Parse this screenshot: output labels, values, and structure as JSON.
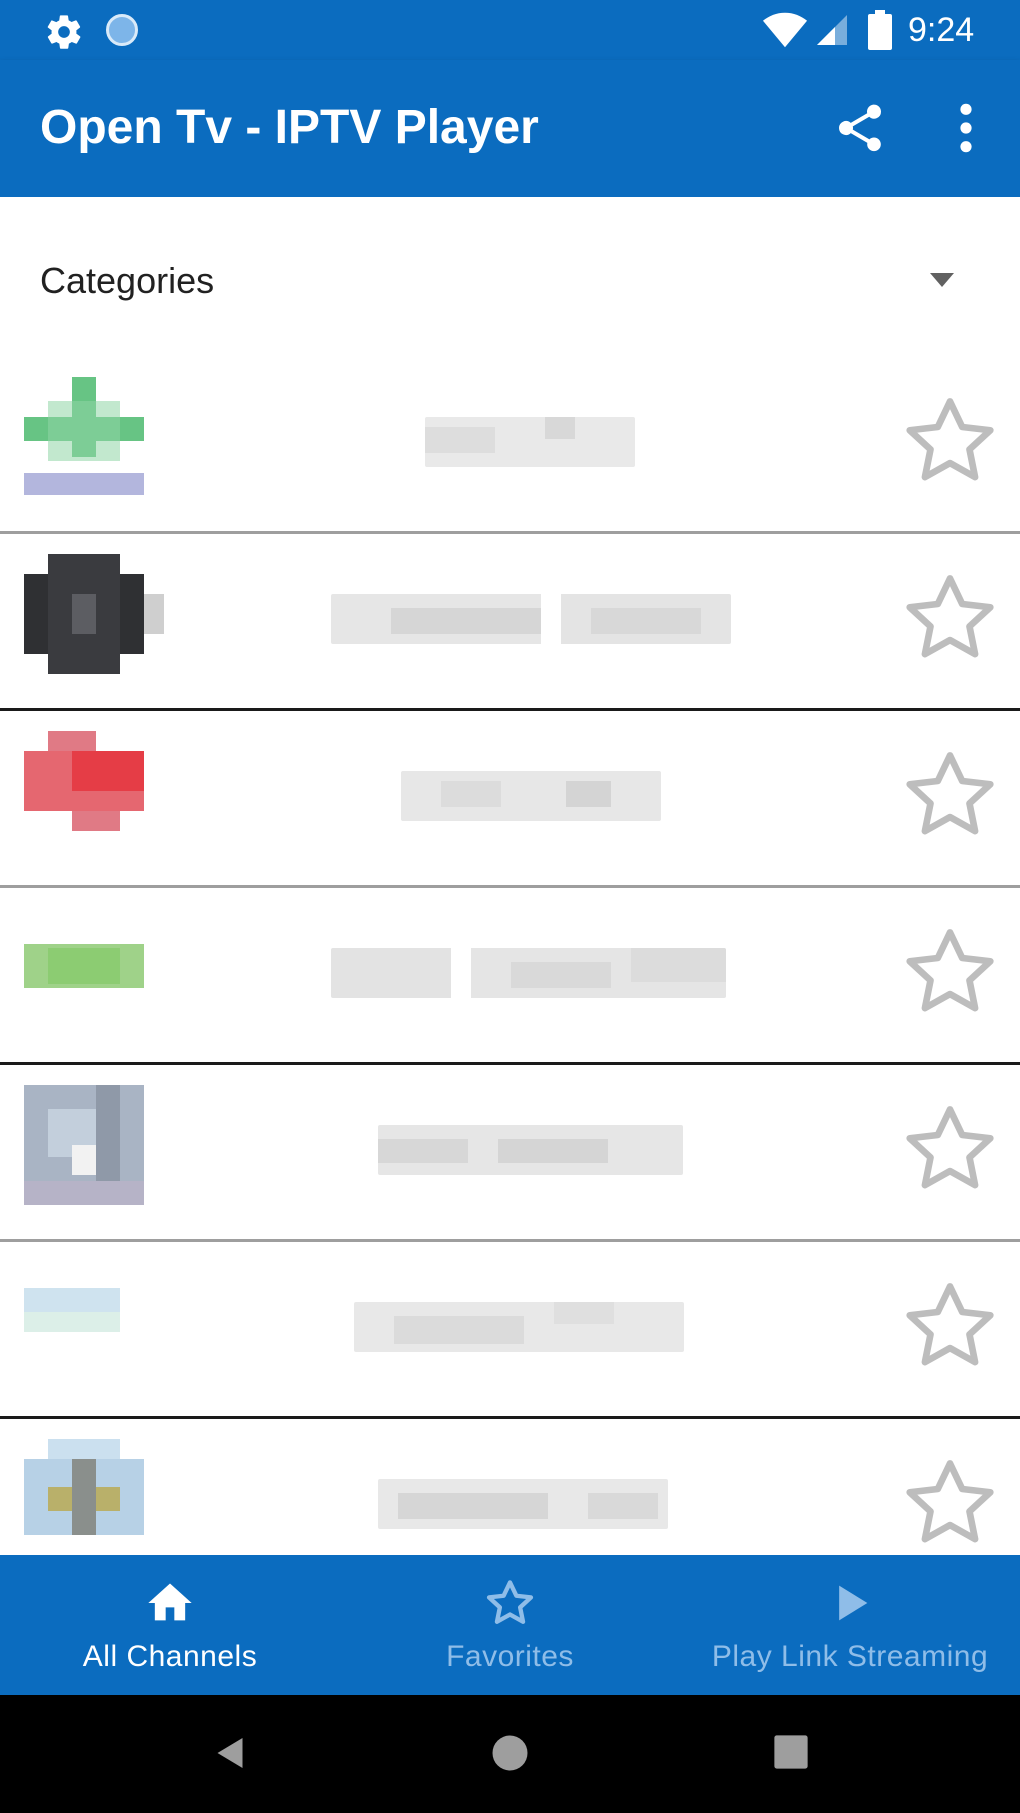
{
  "status_bar": {
    "time": "9:24",
    "icons": [
      "settings-gear-icon",
      "notification-dot-icon",
      "wifi-icon",
      "cell-signal-icon",
      "battery-icon"
    ]
  },
  "app_bar": {
    "title": "Open Tv - IPTV Player",
    "actions": [
      "share-icon",
      "more-vert-icon"
    ]
  },
  "categories": {
    "label": "Categories",
    "icon": "dropdown-arrow-icon"
  },
  "channels": [
    {
      "logo": "blurred-channel-logo",
      "name_blurred": true,
      "favorite": false
    },
    {
      "logo": "blurred-channel-logo",
      "name_blurred": true,
      "favorite": false
    },
    {
      "logo": "blurred-channel-logo",
      "name_blurred": true,
      "favorite": false
    },
    {
      "logo": "blurred-channel-logo",
      "name_blurred": true,
      "favorite": false
    },
    {
      "logo": "blurred-channel-logo",
      "name_blurred": true,
      "favorite": false
    },
    {
      "logo": "blurred-channel-logo",
      "name_blurred": true,
      "favorite": false
    },
    {
      "logo": "blurred-channel-logo",
      "name_blurred": true,
      "favorite": false
    }
  ],
  "bottom_nav": {
    "items": [
      {
        "label": "All Channels",
        "icon": "home-icon",
        "active": true
      },
      {
        "label": "Favorites",
        "icon": "star-icon",
        "active": false
      },
      {
        "label": "Play Link Streaming",
        "icon": "play-icon",
        "active": false
      }
    ]
  },
  "system_nav": {
    "icons": [
      "back-icon",
      "home-circle-icon",
      "recents-icon"
    ]
  },
  "colors": {
    "primary": "#0b6cbf",
    "inactive_nav": "#8fbde8",
    "star_outline": "#bdbdbd"
  }
}
